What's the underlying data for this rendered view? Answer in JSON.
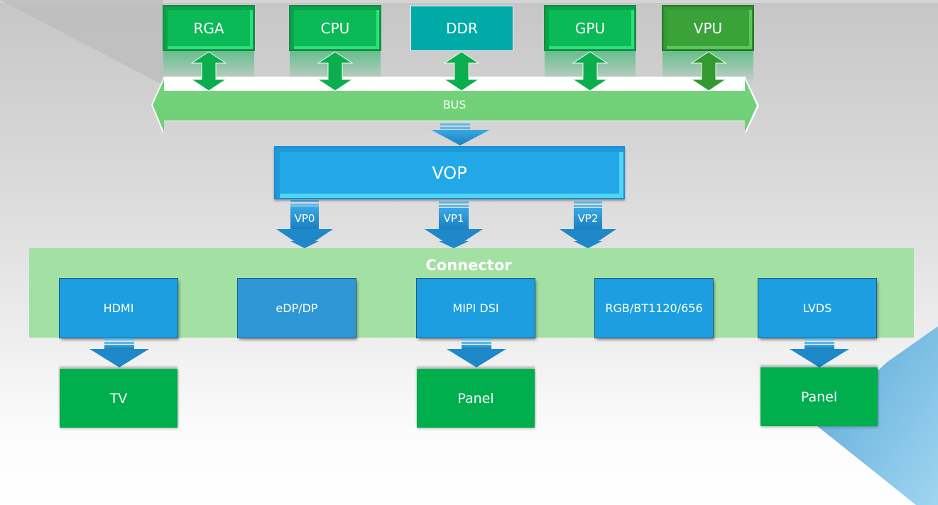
{
  "diagram": {
    "bus": {
      "label": "BUS",
      "color": "#74d37a",
      "masters": [
        {
          "id": "rga",
          "label": "RGA",
          "color": "#0bb956"
        },
        {
          "id": "cpu",
          "label": "CPU",
          "color": "#0bb956"
        },
        {
          "id": "ddr",
          "label": "DDR",
          "color": "#00aaa6"
        },
        {
          "id": "gpu",
          "label": "GPU",
          "color": "#0bb956"
        },
        {
          "id": "vpu",
          "label": "VPU",
          "color": "#3ba23a"
        }
      ]
    },
    "vop": {
      "label": "VOP",
      "color": "#22a8e8",
      "ports": [
        {
          "id": "vp0",
          "label": "VP0"
        },
        {
          "id": "vp1",
          "label": "VP1"
        },
        {
          "id": "vp2",
          "label": "VP2"
        }
      ]
    },
    "connector": {
      "title": "Connector",
      "color": "#a2e0a4",
      "items": [
        {
          "id": "hdmi",
          "label": "HDMI"
        },
        {
          "id": "edp",
          "label": "eDP/DP"
        },
        {
          "id": "mipi",
          "label": "MIPI DSI"
        },
        {
          "id": "rgb",
          "label": "RGB/BT1120/656"
        },
        {
          "id": "lvds",
          "label": "LVDS"
        }
      ]
    },
    "outputs": [
      {
        "id": "tv",
        "label": "TV",
        "source": "HDMI"
      },
      {
        "id": "panel-mipi",
        "label": "Panel",
        "source": "MIPI DSI"
      },
      {
        "id": "panel-lvds",
        "label": "Panel",
        "source": "LVDS"
      }
    ],
    "edges": [
      {
        "from": "RGA",
        "to": "BUS",
        "type": "bidirectional"
      },
      {
        "from": "CPU",
        "to": "BUS",
        "type": "bidirectional"
      },
      {
        "from": "DDR",
        "to": "BUS",
        "type": "bidirectional"
      },
      {
        "from": "GPU",
        "to": "BUS",
        "type": "bidirectional"
      },
      {
        "from": "VPU",
        "to": "BUS",
        "type": "bidirectional"
      },
      {
        "from": "BUS",
        "to": "VOP",
        "type": "directed"
      },
      {
        "from": "VOP",
        "to": "Connector",
        "label": "VP0",
        "type": "directed"
      },
      {
        "from": "VOP",
        "to": "Connector",
        "label": "VP1",
        "type": "directed"
      },
      {
        "from": "VOP",
        "to": "Connector",
        "label": "VP2",
        "type": "directed"
      },
      {
        "from": "HDMI",
        "to": "TV",
        "type": "directed"
      },
      {
        "from": "MIPI DSI",
        "to": "Panel",
        "type": "directed"
      },
      {
        "from": "LVDS",
        "to": "Panel",
        "type": "directed"
      }
    ]
  }
}
